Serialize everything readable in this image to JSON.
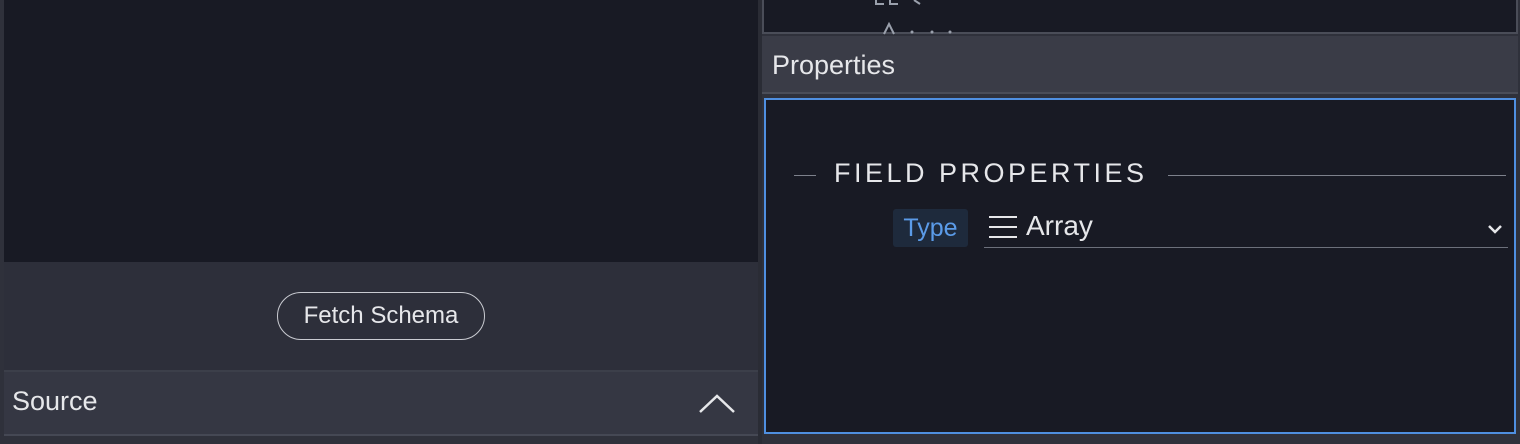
{
  "left": {
    "fetch_button": "Fetch Schema",
    "source_label": "Source",
    "source_toggle_icon": "chevron-up-icon"
  },
  "right": {
    "properties_title": "Properties",
    "section_title": "FIELD PROPERTIES",
    "type_label": "Type",
    "type_value": "Array",
    "type_value_icon": "list-icon"
  },
  "colors": {
    "accent": "#4f8fe0",
    "type_label_text": "#5b9be8",
    "panel_bg": "#181a24",
    "app_bg": "#2f313b"
  }
}
